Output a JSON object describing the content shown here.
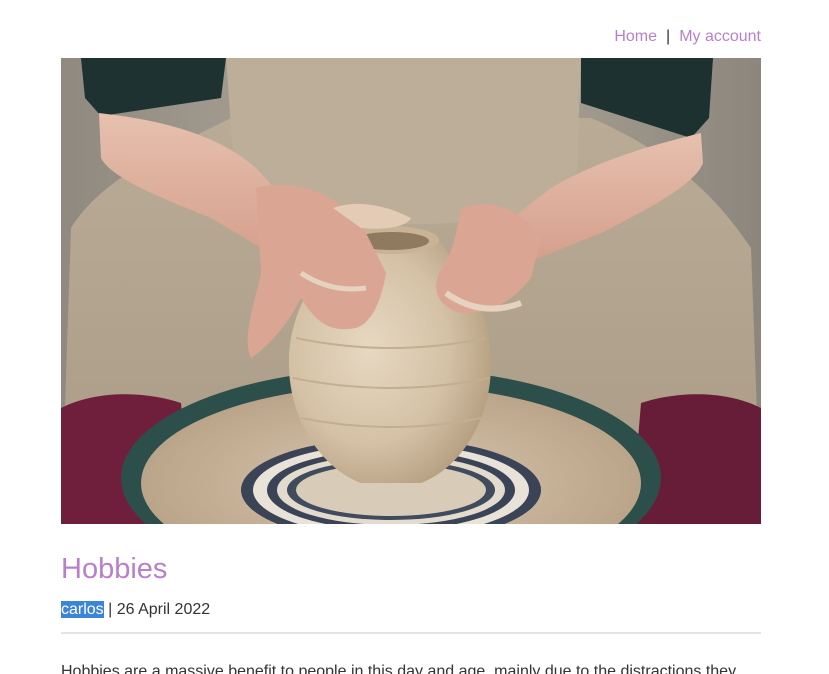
{
  "nav": {
    "home_label": "Home",
    "separator": "|",
    "account_label": "My account"
  },
  "hero": {
    "alt": "Hands shaping a clay pot on a pottery wheel"
  },
  "post": {
    "title": "Hobbies",
    "author": "carlos",
    "meta_separator": " | ",
    "date": "26 April 2022",
    "body_start": "Hobbies are a massive benefit to people in this day and age, mainly due to the distractions they"
  },
  "colors": {
    "accent": "#b97fcb",
    "author_highlight": "#3c84d6",
    "text": "#333333",
    "divider": "#e4e4e4"
  }
}
